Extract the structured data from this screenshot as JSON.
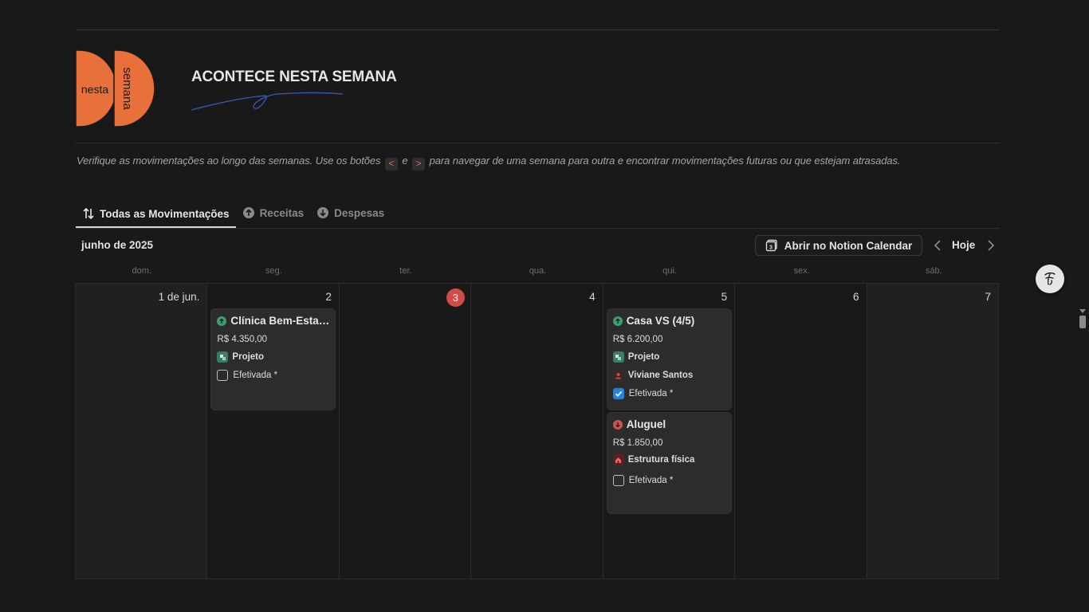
{
  "header": {
    "logo_word_left": "nesta",
    "logo_word_right": "semana",
    "title": "ACONTECE NESTA SEMANA",
    "accent_color": "#e8703a"
  },
  "description": {
    "before": "Verifique as movimentações ao longo das semanas. Use os botões",
    "prev_key": "<",
    "middle": "e",
    "next_key": ">",
    "after": "para navegar de uma semana para outra e encontrar movimentações futuras ou que estejam atrasadas."
  },
  "tabs": [
    {
      "label": "Todas as Movimentações",
      "icon": "sort-arrows-icon",
      "active": true
    },
    {
      "label": "Receitas",
      "icon": "arrow-up-circle-icon",
      "active": false
    },
    {
      "label": "Despesas",
      "icon": "arrow-down-circle-icon",
      "active": false
    }
  ],
  "calendar": {
    "month_label": "junho de 2025",
    "open_button": "Abrir no Notion Calendar",
    "today_button": "Hoje",
    "weekdays": [
      "dom.",
      "seg.",
      "ter.",
      "qua.",
      "qui.",
      "sex.",
      "sáb."
    ],
    "days": [
      "1 de jun.",
      "2",
      "3",
      "4",
      "5",
      "6",
      "7"
    ],
    "today_index": 2,
    "today_color": "#d14b4b"
  },
  "events": {
    "clinica": {
      "title": "Clínica Bem-Estar Vida",
      "amount": "R$ 4.350,00",
      "category": "Projeto",
      "status_label": "Efetivada *",
      "checked": false
    },
    "casa": {
      "title": "Casa VS (4/5)",
      "amount": "R$ 6.200,00",
      "category": "Projeto",
      "client": "Viviane Santos",
      "status_label": "Efetivada *",
      "checked": true
    },
    "aluguel": {
      "title": "Aluguel",
      "amount": "R$ 1.850,00",
      "category": "Estrutura física",
      "status_label": "Efetivada *",
      "checked": false
    }
  }
}
